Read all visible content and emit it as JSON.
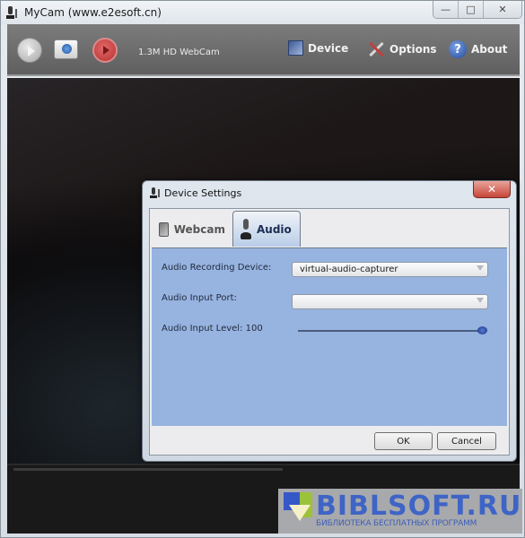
{
  "window": {
    "title": "MyCam (www.e2esoft.cn)",
    "controls": {
      "minimize": "—",
      "maximize": "□",
      "close": "✕"
    }
  },
  "toolbar": {
    "camera_name": "1.3M HD WebCam",
    "menu": {
      "device": "Device",
      "options": "Options",
      "about": "About",
      "about_glyph": "?"
    }
  },
  "dialog": {
    "title": "Device Settings",
    "close_glyph": "✕",
    "tabs": [
      {
        "label": "Webcam",
        "active": false
      },
      {
        "label": "Audio",
        "active": true
      }
    ],
    "fields": {
      "recording_device_label": "Audio Recording Device:",
      "recording_device_value": "virtual-audio-capturer",
      "input_port_label": "Audio Input Port:",
      "input_port_value": "",
      "input_level_label": "Audio Input Level: 100",
      "input_level_value": 100,
      "input_level_max": 100
    },
    "buttons": {
      "ok": "OK",
      "cancel": "Cancel"
    }
  },
  "watermark": {
    "title": "BIBLSOFT.RU",
    "subtitle": "БИБЛИОТЕКА БЕСПЛАТНЫХ ПРОГРАММ"
  }
}
